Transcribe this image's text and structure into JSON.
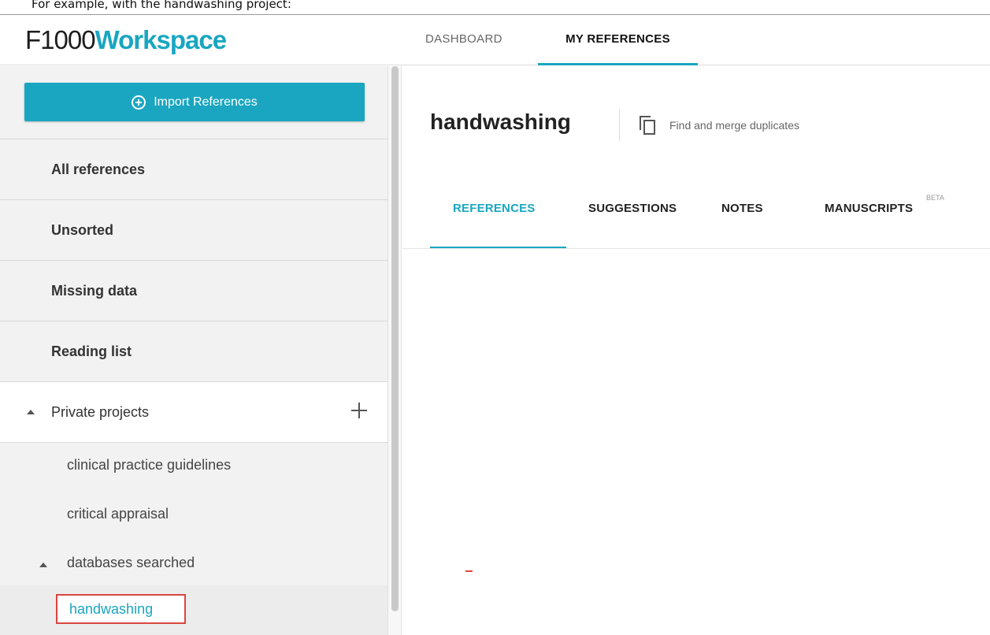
{
  "caption": {
    "text": "For example, with the handwashing project:"
  },
  "header": {
    "logo_prefix": "F1000",
    "logo_suffix": "Workspace",
    "nav_tabs": [
      "DASHBOARD",
      "MY REFERENCES"
    ],
    "active_nav": "MY REFERENCES"
  },
  "sidebar": {
    "import_label": "Import References",
    "items": [
      {
        "label": "All references"
      },
      {
        "label": "Unsorted"
      },
      {
        "label": "Missing data"
      },
      {
        "label": "Reading list"
      }
    ],
    "private_projects": {
      "label": "Private projects",
      "projects": [
        {
          "label": "clinical practice guidelines"
        },
        {
          "label": "critical appraisal"
        },
        {
          "label": "databases searched"
        }
      ],
      "selected_subproject": "handwashing"
    }
  },
  "main": {
    "title": "handwashing",
    "duplicates_label": "Find and merge duplicates",
    "tabs": [
      {
        "label": "REFERENCES"
      },
      {
        "label": "SUGGESTIONS"
      },
      {
        "label": "NOTES"
      },
      {
        "label": "MANUSCRIPTS"
      }
    ],
    "active_tab": "REFERENCES",
    "beta_badge": "BETA"
  },
  "colors": {
    "accent": "#1aa6c0",
    "highlight_border": "#d9463e"
  }
}
